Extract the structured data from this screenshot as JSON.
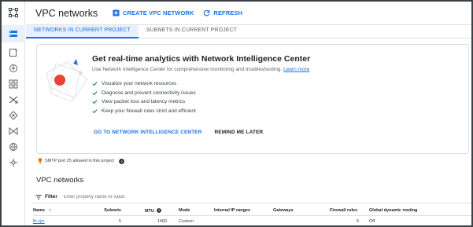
{
  "header": {
    "title": "VPC networks",
    "create_label": "CREATE VPC NETWORK",
    "refresh_label": "REFRESH"
  },
  "tabs": [
    {
      "label": "NETWORKS IN CURRENT PROJECT",
      "active": true
    },
    {
      "label": "SUBNETS IN CURRENT PROJECT",
      "active": false
    }
  ],
  "banner": {
    "headline": "Get real-time analytics with Network Intelligence Center",
    "subtitle": "Use Network Intelligence Center for comprehensive monitoring and troubleshooting.",
    "learn_more": "Learn more",
    "features": [
      "Visualize your network resources",
      "Diagnose and prevent connectivity issues",
      "View packet loss and latency metrics",
      "Keep your firewall rules strict and efficient"
    ],
    "primary_action": "GO TO NETWORK INTELLIGENCE CENTER",
    "secondary_action": "REMIND ME LATER"
  },
  "smtp_note": "SMTP port 25 allowed in this project",
  "section": {
    "title": "VPC networks",
    "filter_label": "Filter",
    "filter_placeholder": "Enter property name or value"
  },
  "table": {
    "headers": {
      "name": "Name",
      "subnets": "Subnets",
      "mtu": "MTU",
      "mode": "Mode",
      "internal_ip": "Internal IP ranges",
      "gateways": "Gateways",
      "firewall": "Firewall rules",
      "routing": "Global dynamic routing"
    },
    "rows": [
      {
        "name": "lb-vpc",
        "subnets": "5",
        "mtu": "1460",
        "mode": "Custom",
        "internal_ip": "",
        "gateways": "",
        "firewall": "5",
        "routing": "Off"
      }
    ]
  },
  "colors": {
    "accent": "#1a73e8",
    "check": "#1e8e3e",
    "illus_red": "#ea4335",
    "illus_blue": "#1a73e8"
  }
}
